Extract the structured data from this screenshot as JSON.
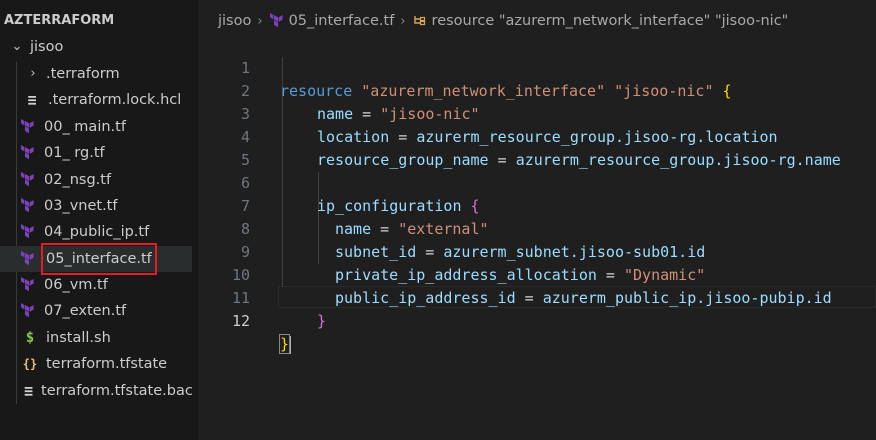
{
  "explorer": {
    "root": "AZTERRAFORM",
    "items": [
      {
        "label": "jisoo",
        "type": "folder-open",
        "icon": "chevron-down-icon"
      },
      {
        "label": ".terraform",
        "type": "folder",
        "icon": "chevron-right-icon"
      },
      {
        "label": ".terraform.lock.hcl",
        "type": "file",
        "icon": "lines-file-icon"
      },
      {
        "label": "00_ main.tf",
        "type": "tf",
        "icon": "terraform-icon"
      },
      {
        "label": "01_ rg.tf",
        "type": "tf",
        "icon": "terraform-icon"
      },
      {
        "label": "02_nsg.tf",
        "type": "tf",
        "icon": "terraform-icon"
      },
      {
        "label": "03_vnet.tf",
        "type": "tf",
        "icon": "terraform-icon"
      },
      {
        "label": "04_public_ip.tf",
        "type": "tf",
        "icon": "terraform-icon"
      },
      {
        "label": "05_interface.tf",
        "type": "tf",
        "icon": "terraform-icon",
        "selected": true
      },
      {
        "label": "06_vm.tf",
        "type": "tf",
        "icon": "terraform-icon"
      },
      {
        "label": "07_exten.tf",
        "type": "tf",
        "icon": "terraform-icon"
      },
      {
        "label": "install.sh",
        "type": "sh",
        "icon": "dollar-icon"
      },
      {
        "label": "terraform.tfstate",
        "type": "json",
        "icon": "braces-icon"
      },
      {
        "label": "terraform.tfstate.bac...",
        "type": "file",
        "icon": "lines-file-icon"
      }
    ]
  },
  "breadcrumb": {
    "folder": "jisoo",
    "file": "05_interface.tf",
    "symbol": "resource \"azurerm_network_interface\" \"jisoo-nic\""
  },
  "editor": {
    "active_line": 12,
    "lines": [
      {
        "n": "1"
      },
      {
        "n": "2"
      },
      {
        "n": "3"
      },
      {
        "n": "4"
      },
      {
        "n": "5"
      },
      {
        "n": "6"
      },
      {
        "n": "7"
      },
      {
        "n": "8"
      },
      {
        "n": "9"
      },
      {
        "n": "10"
      },
      {
        "n": "11"
      },
      {
        "n": "12"
      }
    ],
    "code": {
      "l1_kw": "resource",
      "l1_s1": "\"azurerm_network_interface\"",
      "l1_s2": "\"jisoo-nic\"",
      "l1_brace": "{",
      "l2_attr": "name",
      "l2_eq": " = ",
      "l2_val": "\"jisoo-nic\"",
      "l3_attr": "location",
      "l3_eq": " = ",
      "l3_val": "azurerm_resource_group.jisoo-rg.location",
      "l4_attr": "resource_group_name",
      "l4_eq": " = ",
      "l4_val": "azurerm_resource_group.jisoo-rg.name",
      "l6_attr": "ip_configuration",
      "l6_brace": "{",
      "l7_attr": "name",
      "l7_eq": " = ",
      "l7_val": "\"external\"",
      "l8_attr": "subnet_id",
      "l8_eq": " = ",
      "l8_val": "azurerm_subnet.jisoo-sub01.id",
      "l9_attr": "private_ip_address_allocation",
      "l9_eq": " = ",
      "l9_val": "\"Dynamic\"",
      "l10_attr": "public_ip_address_id",
      "l10_eq": " = ",
      "l10_val": "azurerm_public_ip.jisoo-pubip.id",
      "l11_brace": "}",
      "l12_brace": "}"
    }
  },
  "colors": {
    "keyword": "#569cd6",
    "string": "#ce9178",
    "attribute": "#9cdcfe",
    "terraform_icon": "#7b42bc",
    "selection_outline": "#e51c23"
  }
}
